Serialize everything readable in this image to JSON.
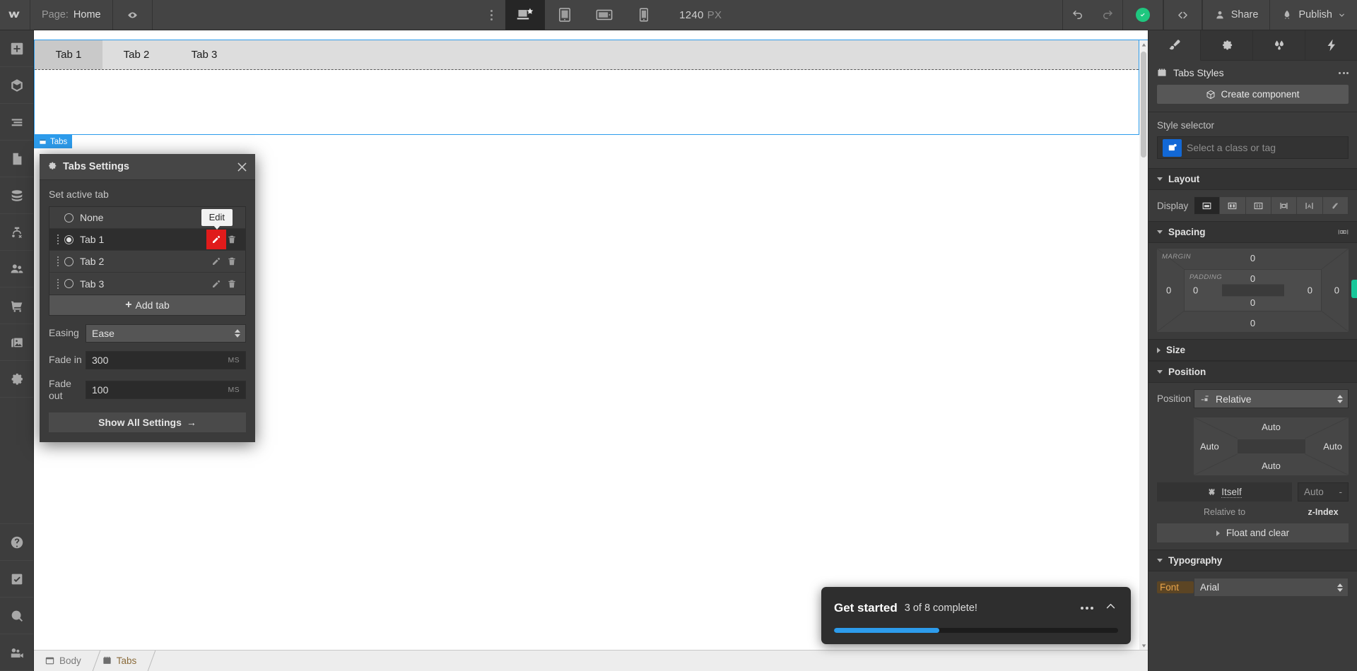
{
  "topbar": {
    "logo_icon": "webflow-logo-icon",
    "page_label": "Page:",
    "page_name": "Home",
    "preview_icon": "eye-icon",
    "more_icon": "vertical-dots-icon",
    "breakpoints": [
      {
        "name": "desktop-breakpoint",
        "icon": "desktop-star-icon",
        "active": true
      },
      {
        "name": "tablet-breakpoint",
        "icon": "tablet-icon",
        "active": false
      },
      {
        "name": "mobile-landscape-breakpoint",
        "icon": "mobile-landscape-icon",
        "active": false
      },
      {
        "name": "mobile-portrait-breakpoint",
        "icon": "mobile-portrait-icon",
        "active": false
      }
    ],
    "viewport_value": "1240",
    "viewport_unit": "PX",
    "undo_icon": "undo-icon",
    "redo_icon": "redo-icon",
    "status_icon": "check-circle-icon",
    "code_icon": "code-brackets-icon",
    "share_label": "Share",
    "publish_label": "Publish"
  },
  "rail": {
    "items": [
      {
        "name": "add-elements",
        "icon": "plus-square-icon"
      },
      {
        "name": "components",
        "icon": "cube-icon"
      },
      {
        "name": "navigator",
        "icon": "layers-list-icon"
      },
      {
        "name": "pages",
        "icon": "page-icon"
      },
      {
        "name": "cms",
        "icon": "database-icon"
      },
      {
        "name": "logic",
        "icon": "logic-flow-icon"
      },
      {
        "name": "users",
        "icon": "users-icon"
      },
      {
        "name": "ecommerce",
        "icon": "cart-icon"
      },
      {
        "name": "assets",
        "icon": "images-icon"
      },
      {
        "name": "settings",
        "icon": "gear-icon"
      }
    ],
    "bottom_items": [
      {
        "name": "help",
        "icon": "question-circle-icon"
      },
      {
        "name": "audit",
        "icon": "checkbox-check-icon"
      },
      {
        "name": "search",
        "icon": "magnifier-icon"
      },
      {
        "name": "video",
        "icon": "video-camera-icon"
      }
    ]
  },
  "canvas": {
    "tabs": [
      {
        "label": "Tab 1",
        "current": true
      },
      {
        "label": "Tab 2",
        "current": false
      },
      {
        "label": "Tab 3",
        "current": false
      }
    ],
    "selected_badge": "Tabs"
  },
  "breadcrumb": {
    "items": [
      {
        "label": "Body",
        "icon": "body-window-icon"
      },
      {
        "label": "Tabs",
        "icon": "tabs-icon"
      }
    ]
  },
  "settings_modal": {
    "gear_icon": "gear-icon",
    "title": "Tabs Settings",
    "close_icon": "close-icon",
    "set_active_label": "Set active tab",
    "tooltip": "Edit",
    "tabs": [
      {
        "label": "None",
        "selected": false,
        "draggable": false,
        "actions": false
      },
      {
        "label": "Tab 1",
        "selected": true,
        "draggable": true,
        "actions": true,
        "edit_highlighted": true
      },
      {
        "label": "Tab 2",
        "selected": false,
        "draggable": true,
        "actions": true,
        "edit_highlighted": false
      },
      {
        "label": "Tab 3",
        "selected": false,
        "draggable": true,
        "actions": true,
        "edit_highlighted": false
      }
    ],
    "add_tab_label": "Add tab",
    "easing_label": "Easing",
    "easing_value": "Ease",
    "fade_in_label": "Fade in",
    "fade_in_value": "300",
    "fade_in_unit": "MS",
    "fade_out_label": "Fade out",
    "fade_out_value": "100",
    "fade_out_unit": "MS",
    "show_all_label": "Show All Settings",
    "highlight_color": "#e01b1b"
  },
  "get_started": {
    "title": "Get started",
    "subtitle": "3 of 8 complete!",
    "more_icon": "horizontal-dots-icon",
    "collapse_icon": "chevron-up-icon",
    "progress_percent": 37,
    "progress_color": "#2d9cec"
  },
  "right_panel": {
    "tabs": [
      {
        "name": "style-panel-tab",
        "icon": "paintbrush-icon",
        "active": true
      },
      {
        "name": "settings-panel-tab",
        "icon": "gear-icon",
        "active": false
      },
      {
        "name": "interactions-panel-tab",
        "icon": "droplets-icon",
        "active": false
      },
      {
        "name": "effects-panel-tab",
        "icon": "lightning-bolt-icon",
        "active": false
      }
    ],
    "styles_title": "Tabs Styles",
    "styles_icon": "tabs-tag-icon",
    "create_component_label": "Create component",
    "create_component_icon": "cube-icon",
    "style_selector_label": "Style selector",
    "style_selector_placeholder": "Select a class or tag",
    "layout": {
      "title": "Layout",
      "display_label": "Display",
      "options": [
        {
          "name": "display-block",
          "icon": "block-icon",
          "active": true
        },
        {
          "name": "display-flex",
          "icon": "flex-icon",
          "active": false
        },
        {
          "name": "display-grid",
          "icon": "grid-icon",
          "active": false
        },
        {
          "name": "display-inline-block",
          "icon": "inline-block-icon",
          "active": false
        },
        {
          "name": "display-inline",
          "icon": "inline-icon",
          "active": false
        },
        {
          "name": "display-none",
          "icon": "none-hidden-icon",
          "active": false
        }
      ]
    },
    "spacing": {
      "title": "Spacing",
      "margin_label": "MARGIN",
      "padding_label": "PADDING",
      "margin_top": "0",
      "margin_right": "0",
      "margin_bottom": "0",
      "margin_left": "0",
      "padding_top": "0",
      "padding_right": "0",
      "padding_bottom": "0",
      "padding_left": "0"
    },
    "size": {
      "title": "Size"
    },
    "position": {
      "title": "Position",
      "position_label": "Position",
      "position_value": "Relative",
      "top": "Auto",
      "right": "Auto",
      "bottom": "Auto",
      "left": "Auto",
      "itself_label": "Itself",
      "itself_icon": "anchor-node-icon",
      "z_index_value": "Auto",
      "z_index_dash": "-",
      "relative_to_label": "Relative to",
      "z_index_label": "z-Index",
      "float_clear_label": "Float and clear"
    },
    "typography": {
      "title": "Typography",
      "font_label": "Font",
      "font_value": "Arial"
    }
  }
}
